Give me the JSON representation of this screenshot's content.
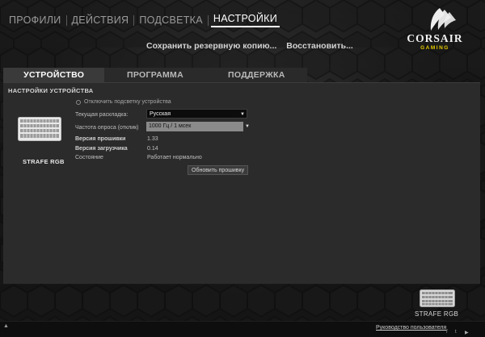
{
  "nav": {
    "items": [
      {
        "label": "ПРОФИЛИ",
        "active": false
      },
      {
        "label": "ДЕЙСТВИЯ",
        "active": false
      },
      {
        "label": "ПОДСВЕТКА",
        "active": false
      },
      {
        "label": "НАСТРОЙКИ",
        "active": true
      }
    ]
  },
  "logo": {
    "brand": "CORSAIR",
    "sub": "GAMING",
    "brand_color": "#f2f2f2",
    "sub_color": "#e7c900"
  },
  "actions": {
    "backup": "Сохранить резервную копию...",
    "restore": "Восстановить..."
  },
  "tabs": [
    {
      "label": "УСТРОЙСТВО",
      "active": true
    },
    {
      "label": "ПРОГРАММА",
      "active": false
    },
    {
      "label": "ПОДДЕРЖКА",
      "active": false
    }
  ],
  "device_settings": {
    "section_title": "НАСТРОЙКИ УСТРОЙСТВА",
    "device_name": "STRAFE RGB",
    "disable_lighting": "Отключить подсветку устройства",
    "layout_label": "Текущая раскладка:",
    "layout_value": "Русская",
    "polling_label": "Частота опроса (отклик)",
    "polling_value": "1000 Гц / 1 мсек",
    "firmware_label": "Версия прошивки",
    "firmware_value": "1.33",
    "bootloader_label": "Версия загрузчика",
    "bootloader_value": "0.14",
    "status_label": "Состояние",
    "status_value": "Работает нормально",
    "update_button": "Обновить прошивку"
  },
  "bottom": {
    "device_name": "STRAFE RGB",
    "guide_link": "Руководство пользователя",
    "social_icons": [
      "facebook-icon",
      "twitter-icon",
      "youtube-icon"
    ]
  }
}
